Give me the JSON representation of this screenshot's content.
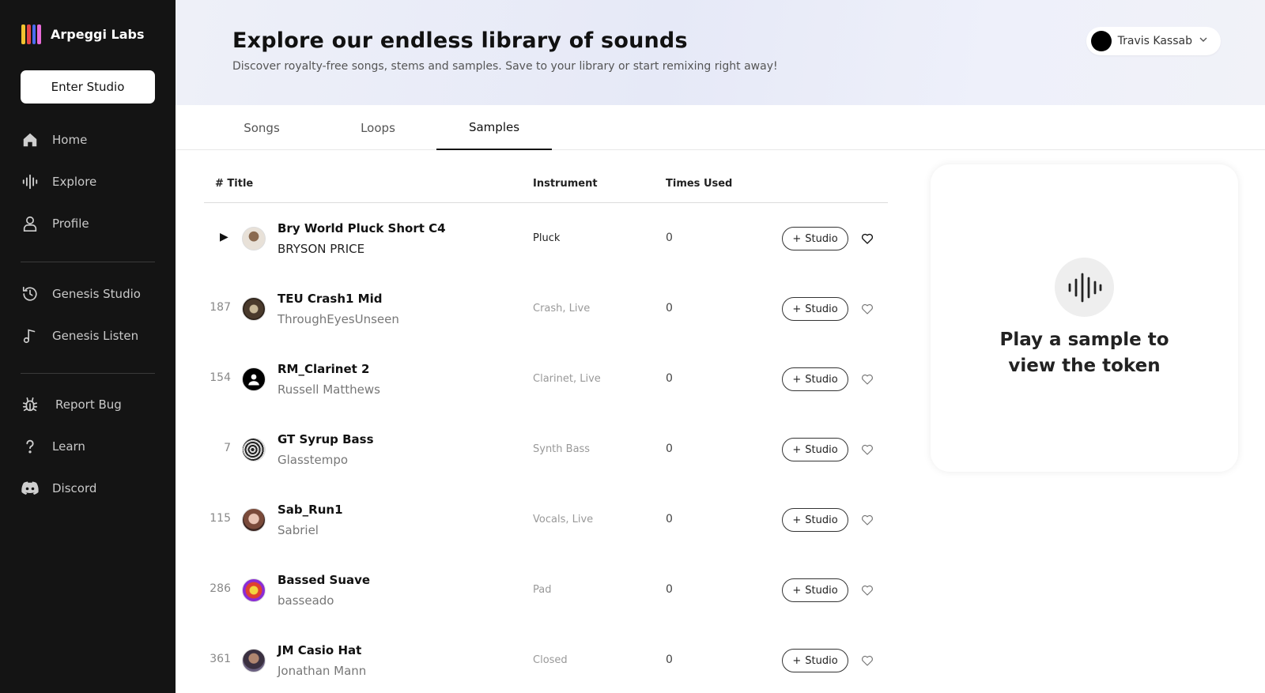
{
  "brand": {
    "name": "Arpeggi Labs",
    "logo_colors": [
      "#f2c230",
      "#e8454a",
      "#4a6cf0",
      "#e86bd8"
    ]
  },
  "sidebar": {
    "enter_studio": "Enter Studio",
    "items": [
      {
        "label": "Home",
        "icon": "home-icon"
      },
      {
        "label": "Explore",
        "icon": "waveform-icon"
      },
      {
        "label": "Profile",
        "icon": "person-icon"
      },
      {
        "label": "Genesis Studio",
        "icon": "history-icon"
      },
      {
        "label": "Genesis Listen",
        "icon": "music-note-icon"
      },
      {
        "label": "Report Bug",
        "icon": "bug-icon"
      },
      {
        "label": "Learn",
        "icon": "question-icon"
      },
      {
        "label": "Discord",
        "icon": "discord-icon"
      }
    ]
  },
  "header": {
    "title": "Explore our endless library of sounds",
    "subtitle": "Discover royalty-free songs, stems and samples. Save to your library or start remixing right away!",
    "user_name": "Travis Kassab"
  },
  "tabs": [
    {
      "label": "Songs",
      "active": false
    },
    {
      "label": "Loops",
      "active": false
    },
    {
      "label": "Samples",
      "active": true
    }
  ],
  "table": {
    "headers": {
      "title": "# Title",
      "instrument": "Instrument",
      "times_used": "Times Used"
    },
    "studio_label": "Studio",
    "rows": [
      {
        "num": "",
        "title": "Bry World Pluck Short C4",
        "artist": "BRYSON PRICE",
        "instrument": "Pluck",
        "times_used": "0",
        "thumb": "#c9b8a0"
      },
      {
        "num": "187",
        "title": "TEU Crash1 Mid",
        "artist": "ThroughEyesUnseen",
        "instrument": "Crash, Live",
        "times_used": "0",
        "thumb": "#5a4a3a"
      },
      {
        "num": "154",
        "title": "RM_Clarinet 2",
        "artist": "Russell Matthews",
        "instrument": "Clarinet, Live",
        "times_used": "0",
        "thumb": "#000000"
      },
      {
        "num": "7",
        "title": "GT Syrup Bass",
        "artist": "Glasstempo",
        "instrument": "Synth Bass",
        "times_used": "0",
        "thumb": "#777777"
      },
      {
        "num": "115",
        "title": "Sab_Run1",
        "artist": "Sabriel",
        "instrument": "Vocals, Live",
        "times_used": "0",
        "thumb": "#c99a88"
      },
      {
        "num": "286",
        "title": "Bassed Suave",
        "artist": "basseado",
        "instrument": "Pad",
        "times_used": "0",
        "thumb": "#c23bd6"
      },
      {
        "num": "361",
        "title": "JM Casio Hat",
        "artist": "Jonathan Mann",
        "instrument": "Closed",
        "times_used": "0",
        "thumb": "#6a6070"
      }
    ]
  },
  "token_card": {
    "text": "Play a sample to view the token"
  }
}
